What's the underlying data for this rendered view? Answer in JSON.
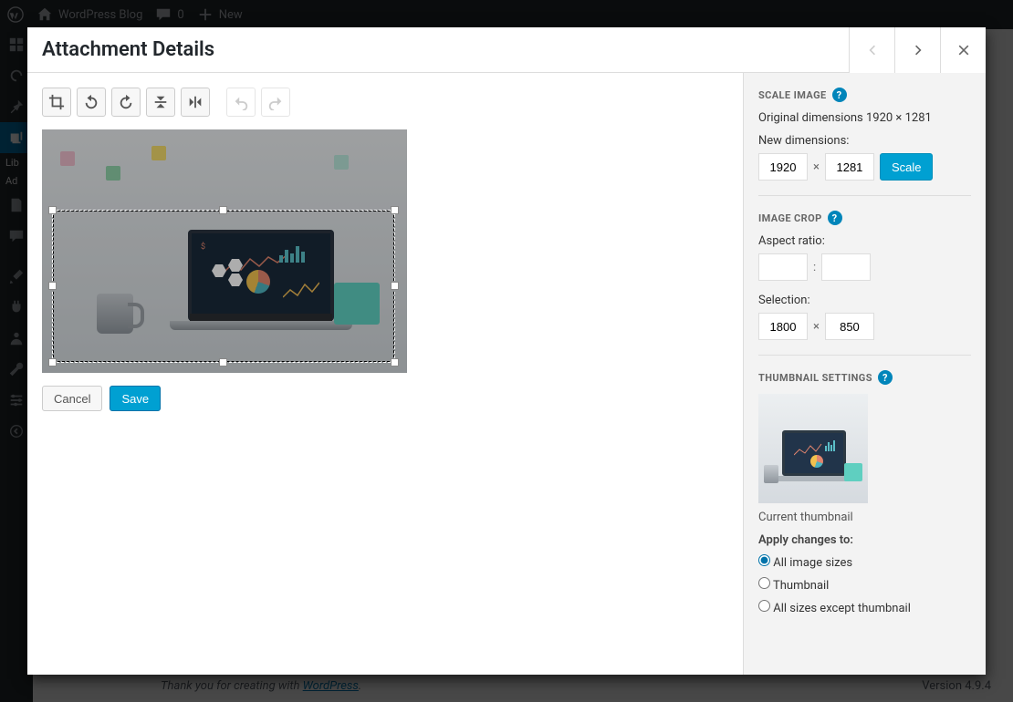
{
  "adminbar": {
    "site_title": "WordPress Blog",
    "comments_count": "0",
    "new_label": "New"
  },
  "sidebar_labels": {
    "library_short": "Lib",
    "add_short": "Ad"
  },
  "footer": {
    "thanks_prefix": "Thank you for creating with ",
    "link_text": "WordPress",
    "thanks_suffix": ".",
    "version": "Version 4.9.4"
  },
  "modal": {
    "title": "Attachment Details"
  },
  "actions": {
    "cancel": "Cancel",
    "save": "Save"
  },
  "scale": {
    "heading": "SCALE IMAGE",
    "original_prefix": "Original dimensions ",
    "original_value": "1920 × 1281",
    "new_dimensions_label": "New dimensions:",
    "width": "1920",
    "height": "1281",
    "separator": "×",
    "button": "Scale"
  },
  "crop": {
    "heading": "IMAGE CROP",
    "aspect_label": "Aspect ratio:",
    "aspect_w": "",
    "aspect_h": "",
    "aspect_sep": ":",
    "selection_label": "Selection:",
    "sel_w": "1800",
    "sel_h": "850",
    "sel_sep": "×"
  },
  "thumb": {
    "heading": "THUMBNAIL SETTINGS",
    "current_label": "Current thumbnail",
    "apply_label": "Apply changes to:",
    "options": {
      "all": "All image sizes",
      "thumbnail": "Thumbnail",
      "except": "All sizes except thumbnail"
    },
    "selected": "all"
  },
  "help_glyph": "?"
}
